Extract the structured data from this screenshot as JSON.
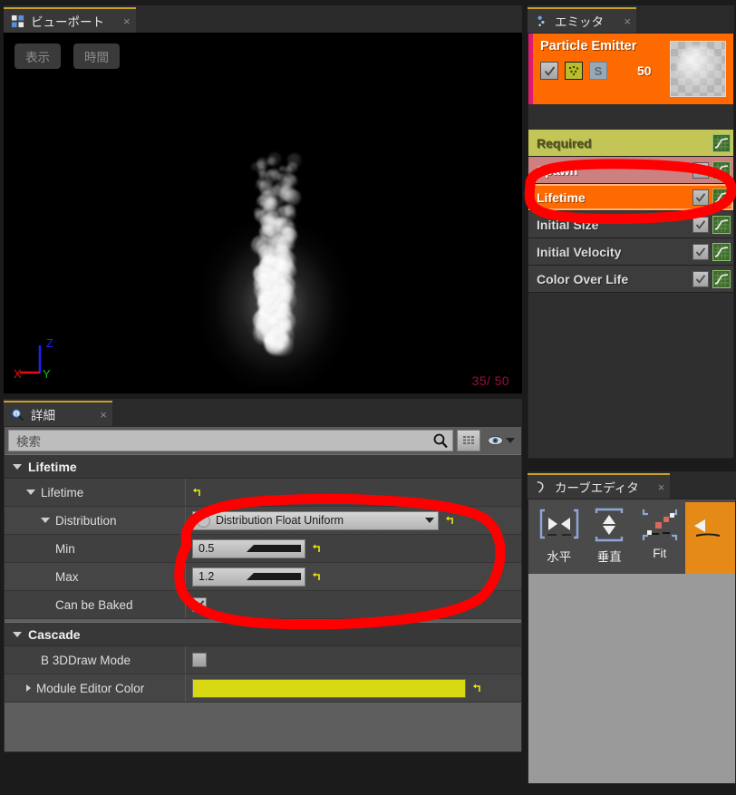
{
  "viewport": {
    "tab_label": "ビューポート",
    "tab_icon": "viewport-grid-icon",
    "close_icon": "×",
    "buttons": [
      {
        "label": "表示",
        "name": "view-menu-button"
      },
      {
        "label": "時間",
        "name": "time-menu-button"
      }
    ],
    "frame_counter": "35/ 50",
    "axis_labels": {
      "x": "X",
      "y": "Y",
      "z": "Z"
    },
    "axis_colors": {
      "x": "#e01010",
      "y": "#10c010",
      "z": "#2020ff"
    }
  },
  "details": {
    "tab_label": "詳細",
    "tab_icon": "details-magnifier-icon",
    "close_icon": "×",
    "search": {
      "placeholder": "検索",
      "value": "",
      "search_icon": "search-icon",
      "grid_icon": "grid-view-icon",
      "eye_icon": "eye-icon",
      "caret_icon": "chevron-down-icon"
    },
    "categories": [
      {
        "name": "Lifetime",
        "rows": [
          {
            "label": "Lifetime",
            "indent": 1,
            "type": "header-reset",
            "expander": "open",
            "reset": true
          },
          {
            "label": "Distribution",
            "indent": 2,
            "type": "combo",
            "expander": "open",
            "value": "Distribution Float Uniform",
            "reset": true
          },
          {
            "label": "Min",
            "indent": 3,
            "type": "number",
            "value": "0.5",
            "reset": true
          },
          {
            "label": "Max",
            "indent": 3,
            "type": "number",
            "value": "1.2",
            "reset": true
          },
          {
            "label": "Can be Baked",
            "indent": 3,
            "type": "checkbox",
            "checked": true
          }
        ]
      },
      {
        "name": "Cascade",
        "rows": [
          {
            "label": "B 3DDraw Mode",
            "indent": 2,
            "type": "checkbox",
            "checked": false
          },
          {
            "label": "Module Editor Color",
            "indent": 1,
            "type": "color",
            "expander": "closed",
            "color": "#d8d813",
            "reset": true
          }
        ]
      }
    ]
  },
  "emitter": {
    "tab_label": "エミッタ",
    "tab_icon": "emitter-icon",
    "close_icon": "×",
    "header": {
      "name": "Particle Emitter",
      "enabled_checkbox": true,
      "render_icon": "emitter-render-icon",
      "solo_badge": "S",
      "count": "50",
      "thumbnail_icon": "material-thumbnail"
    },
    "modules": [
      {
        "label": "Lifetime",
        "color": "#ff6a00",
        "text_color": "#ffffff",
        "selected": true,
        "checkbox": true,
        "curve_icon": true
      },
      {
        "label": "Required",
        "color": "#c3c657",
        "text_color": "#4d4d22",
        "selected": false,
        "checkbox": false,
        "curve_icon": true
      },
      {
        "label": "Spawn",
        "color": "#cd8080",
        "text_color": "#ffffff",
        "selected": false,
        "checkbox": true,
        "curve_icon": true
      },
      {
        "label": "Initial Size",
        "color": "#3c3c3c",
        "text_color": "#dcdcdc",
        "selected": false,
        "checkbox": true,
        "curve_icon": true
      },
      {
        "label": "Initial Velocity",
        "color": "#3c3c3c",
        "text_color": "#dcdcdc",
        "selected": false,
        "checkbox": true,
        "curve_icon": true
      },
      {
        "label": "Color Over Life",
        "color": "#3c3c3c",
        "text_color": "#dcdcdc",
        "selected": false,
        "checkbox": true,
        "curve_icon": true
      }
    ],
    "module_order": [
      "Required",
      "Spawn",
      "Lifetime",
      "Initial Size",
      "Initial Velocity",
      "Color Over Life"
    ]
  },
  "curve_editor": {
    "tab_label": "カーブエディタ",
    "tab_icon": "curve-editor-icon",
    "close_icon": "×",
    "buttons": [
      {
        "label": "水平",
        "name": "fit-horizontal-button",
        "icon": "fit-horizontal-icon",
        "active": false
      },
      {
        "label": "垂直",
        "name": "fit-vertical-button",
        "icon": "fit-vertical-icon",
        "active": false
      },
      {
        "label": "Fit",
        "name": "fit-button",
        "icon": "fit-all-icon",
        "active": false
      },
      {
        "label": "",
        "name": "pan-button",
        "icon": "pan-icon",
        "active": true
      }
    ]
  },
  "annotation": {
    "color": "#ff0000",
    "shapes": "two hand-drawn red ellipses highlighting the Lifetime module row and the Distribution/Min/Max property block"
  }
}
